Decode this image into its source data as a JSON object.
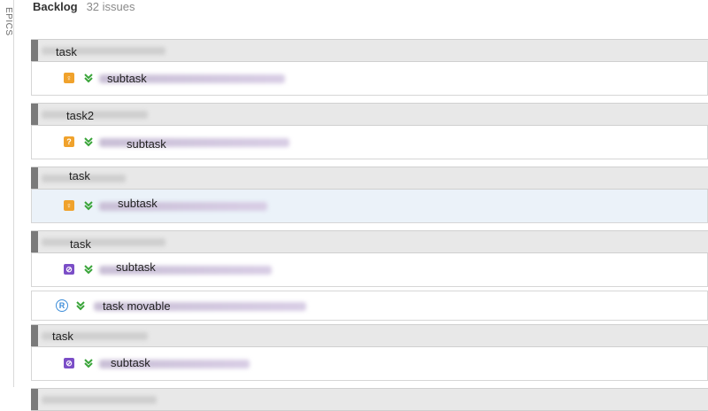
{
  "sidebar": {
    "epics_label": "EPICS"
  },
  "header": {
    "title": "Backlog",
    "count": "32 issues"
  },
  "groups": [
    {
      "parent": "task",
      "child": "subtask",
      "type_icon": "improvement-icon"
    },
    {
      "parent": "task2",
      "child": "subtask",
      "type_icon": "question-icon"
    },
    {
      "parent": "task",
      "child": "subtask",
      "type_icon": "improvement-icon",
      "child_selected": true
    },
    {
      "parent": "task",
      "child": "subtask",
      "type_icon": "purple-type-icon"
    }
  ],
  "standalone": {
    "label": "task movable",
    "type_icon": "resolved-icon"
  },
  "group5": {
    "parent": "task",
    "child": "subtask",
    "type_icon": "purple-type-icon"
  },
  "colors": {
    "parent_bg": "#e8e8e8",
    "selected_bg": "#ebf2f9",
    "orange": "#f0a22c",
    "purple": "#7b4ec7",
    "blue": "#3d8dd9",
    "green": "#3aa53a"
  }
}
